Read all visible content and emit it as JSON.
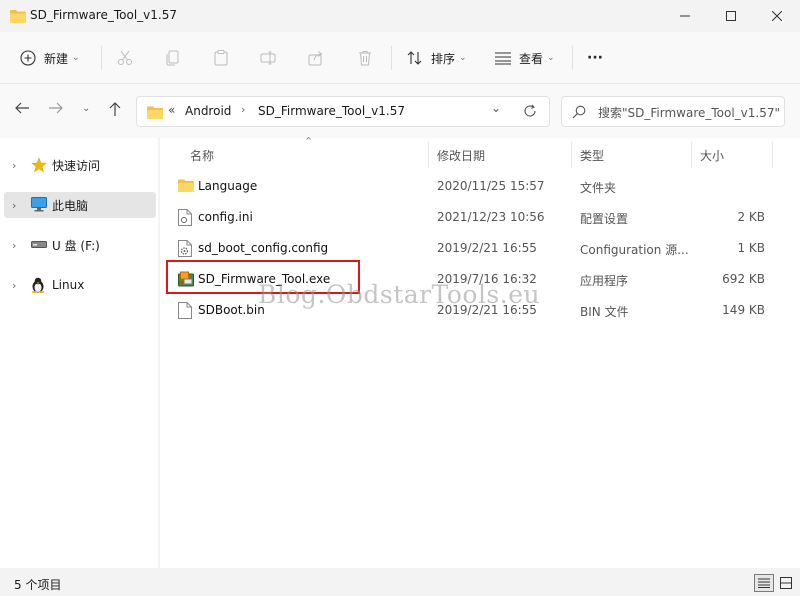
{
  "window": {
    "title": "SD_Firmware_Tool_v1.57"
  },
  "toolbar": {
    "new_label": "新建",
    "sort_label": "排序",
    "view_label": "查看",
    "more_label": "···"
  },
  "address": {
    "overflow": "«",
    "crumbs": [
      "Android",
      "SD_Firmware_Tool_v1.57"
    ]
  },
  "search": {
    "placeholder": "搜索\"SD_Firmware_Tool_v1.57\""
  },
  "sidebar": {
    "items": [
      {
        "label": "快速访问",
        "icon": "star-icon"
      },
      {
        "label": "此电脑",
        "icon": "pc-icon",
        "selected": true
      },
      {
        "label": "U 盘 (F:)",
        "icon": "drive-icon"
      },
      {
        "label": "Linux",
        "icon": "linux-penguin-icon"
      }
    ]
  },
  "columns": {
    "name": "名称",
    "date": "修改日期",
    "type": "类型",
    "size": "大小"
  },
  "files": [
    {
      "name": "Language",
      "date": "2020/11/25 15:57",
      "type": "文件夹",
      "size": "",
      "icon": "folder-icon"
    },
    {
      "name": "config.ini",
      "date": "2021/12/23 10:56",
      "type": "配置设置",
      "size": "2 KB",
      "icon": "ini-file-icon"
    },
    {
      "name": "sd_boot_config.config",
      "date": "2019/2/21 16:55",
      "type": "Configuration 源...",
      "size": "1 KB",
      "icon": "config-file-icon"
    },
    {
      "name": "SD_Firmware_Tool.exe",
      "date": "2019/7/16 16:32",
      "type": "应用程序",
      "size": "692 KB",
      "icon": "exe-app-icon"
    },
    {
      "name": "SDBoot.bin",
      "date": "2019/2/21 16:55",
      "type": "BIN 文件",
      "size": "149 KB",
      "icon": "file-icon"
    }
  ],
  "watermark": "Blog.ObdstarTools.eu",
  "status": {
    "count": "5 个项目"
  },
  "colors": {
    "accent": "#0067c0",
    "highlight": "#d6191b",
    "folder": "#f5c046"
  }
}
